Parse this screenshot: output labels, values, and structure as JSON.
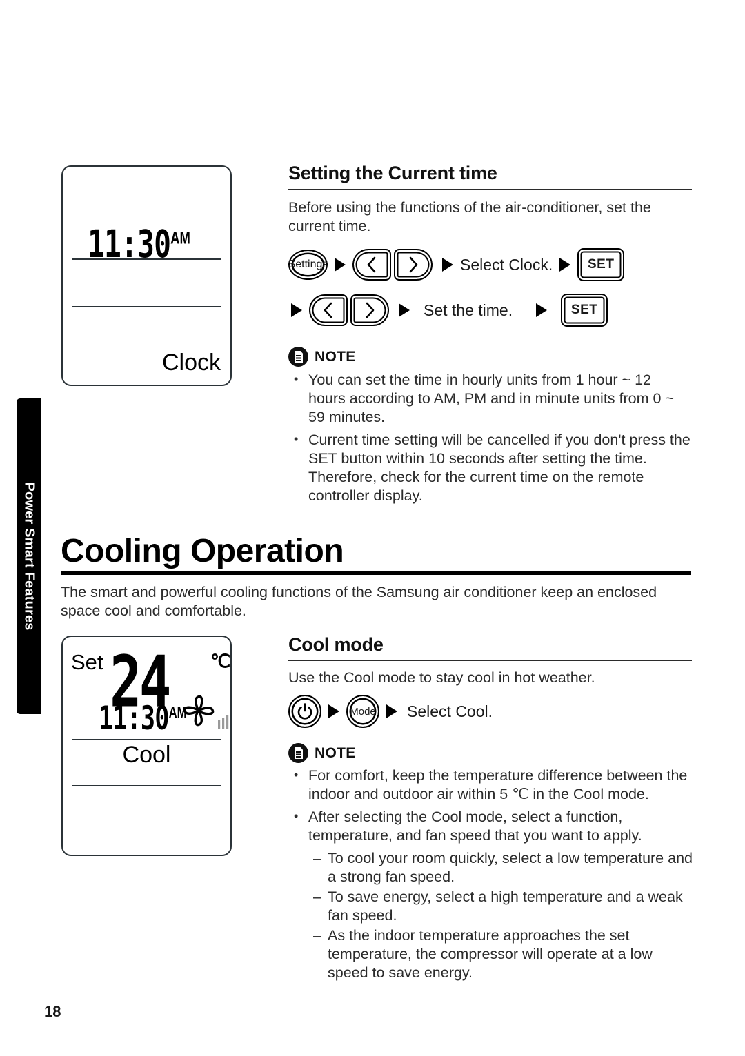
{
  "page": {
    "number": "18",
    "side_tab_label": "Power Smart Features"
  },
  "clock_section": {
    "heading": "Setting the Current time",
    "intro": "Before using the functions of the air-conditioner, set the current time.",
    "steps": [
      {
        "settings_button": "Settings",
        "left_arrow": "chevron-left-icon",
        "right_arrow": "chevron-right-icon",
        "label": "Select Clock.",
        "set_button": "SET"
      },
      {
        "left_arrow": "chevron-left-icon",
        "right_arrow": "chevron-right-icon",
        "label": "Set the time.",
        "set_button": "SET"
      }
    ],
    "note_title": "NOTE",
    "note_icon": "note-document-icon",
    "notes": [
      "You can set the time in hourly units from 1 hour ~ 12 hours according to AM, PM and in minute units from 0 ~ 59 minutes.",
      "Current time setting will be cancelled if you don't press the SET button within 10 seconds after setting the time. Therefore, check for the current time on the remote controller display."
    ]
  },
  "clock_display": {
    "time": "11:30",
    "meridiem": "AM",
    "mode_label": "Clock"
  },
  "cooling_section": {
    "heading": "Cooling Operation",
    "intro": "The smart and powerful cooling functions of the Samsung air conditioner keep an enclosed space cool and comfortable.",
    "subheading": "Cool mode",
    "sub_intro": "Use the Cool mode to stay cool in hot weather.",
    "step": {
      "power_button": "power-icon",
      "mode_button": "Mode",
      "label": "Select Cool."
    },
    "note_title": "NOTE",
    "note_icon": "note-document-icon",
    "notes": [
      "For comfort, keep the temperature difference between the indoor and outdoor air within 5 ℃ in the Cool mode.",
      "After selecting the Cool mode, select a function, temperature, and fan speed that you want to apply."
    ],
    "sub_notes": [
      "To cool your room quickly, select a low temperature and a strong fan speed.",
      "To save energy, select a high temperature and a weak fan speed.",
      "As the indoor temperature approaches the set temperature, the compressor will operate at a low speed to save energy."
    ]
  },
  "cool_display": {
    "set_label": "Set",
    "temperature": "24",
    "unit": "℃",
    "time": "11:30",
    "meridiem": "AM",
    "fan_icon": "fan-blades-icon",
    "fan_speed_icon": "fan-speed-bars-icon",
    "mode_label": "Cool"
  },
  "colors": {
    "ink": "#1a1a1a",
    "lcd_border": "#2b3338",
    "tab_background": "#000000",
    "tab_text": "#ffffff"
  }
}
